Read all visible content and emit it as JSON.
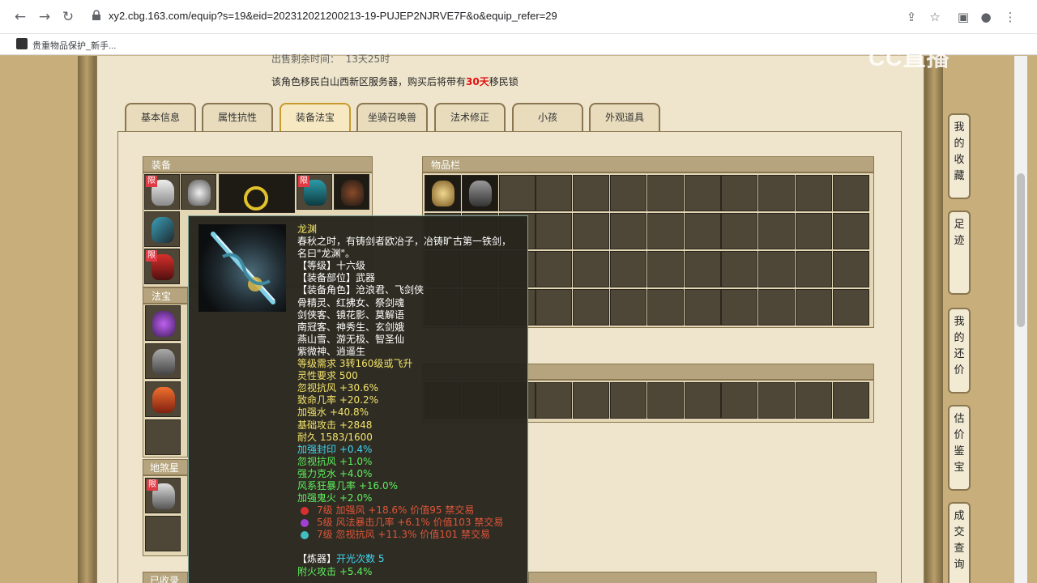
{
  "browser": {
    "url": "xy2.cbg.163.com/equip?s=19&eid=202312021200213-19-PUJEP2NJRVE7F&o&equip_refer=29",
    "bookmark": "贵重物品保护_新手..."
  },
  "watermark": "CC直播",
  "info": {
    "line1_label": "出售剩余时间：",
    "line1_value": "13天25时",
    "line2_pre": "该角色移民白山西新区服务器，购买后将带有",
    "line2_days": "30天",
    "line2_post": "移民锁"
  },
  "tabs": [
    "基本信息",
    "属性抗性",
    "装备法宝",
    "坐骑召唤兽",
    "法术修正",
    "小孩",
    "外观道具"
  ],
  "active_tab": "装备法宝",
  "panels": {
    "equip": "装备",
    "items": "物品栏",
    "magic": "法宝",
    "star": "地煞星",
    "collected": "已收录的"
  },
  "limit_badge": "限",
  "tooltip": {
    "name": "龙渊",
    "lines": [
      {
        "text": "春秋之时，有铸剑者欧冶子，冶铸旷古第一铁剑，",
        "color": "#ffffff"
      },
      {
        "text": "名曰\"龙渊\"。",
        "color": "#ffffff"
      },
      {
        "text": "【等级】十六级",
        "color": "#ffffff"
      },
      {
        "text": "【装备部位】武器",
        "color": "#ffffff"
      },
      {
        "text": "【装备角色】沧浪君、飞剑侠",
        "color": "#ffffff"
      },
      {
        "text": "骨精灵、红拂女、祭剑魂",
        "color": "#ffffff"
      },
      {
        "text": "剑侠客、镜花影、莫解语",
        "color": "#ffffff"
      },
      {
        "text": "南冠客、神秀生、玄剑娥",
        "color": "#ffffff"
      },
      {
        "text": "燕山雪、游无极、智圣仙",
        "color": "#ffffff"
      },
      {
        "text": "紫微神、逍遥生",
        "color": "#ffffff"
      },
      {
        "text": "等级需求 3转160级或飞升",
        "color": "#f3e36a"
      },
      {
        "text": "灵性要求 500",
        "color": "#f3e36a"
      },
      {
        "text": "忽视抗风 +30.6%",
        "color": "#f3e36a"
      },
      {
        "text": "致命几率 +20.2%",
        "color": "#f3e36a"
      },
      {
        "text": "加强水 +40.8%",
        "color": "#f3e36a"
      },
      {
        "text": "基础攻击 +2848",
        "color": "#f3e36a"
      },
      {
        "text": "耐久 1583/1600",
        "color": "#f3e36a"
      },
      {
        "text": "加强封印 +0.4%",
        "color": "#3fd6f0"
      },
      {
        "text": "忽视抗风 +1.0%",
        "color": "#5ef05e"
      },
      {
        "text": "强力克水 +4.0%",
        "color": "#5ef05e"
      },
      {
        "text": "风系狂暴几率 +16.0%",
        "color": "#5ef05e"
      },
      {
        "text": "加强鬼火 +2.0%",
        "color": "#5ef05e"
      }
    ],
    "gems": [
      {
        "text": "7级 加强风 +18.6% 价值95 禁交易",
        "color": "#e0553a",
        "gem": "#d63030"
      },
      {
        "text": "5级 风法暴击几率 +6.1% 价值103 禁交易",
        "color": "#e0553a",
        "gem": "#a040d0"
      },
      {
        "text": "7级 忽视抗风 +11.3% 价值101 禁交易",
        "color": "#e0553a",
        "gem": "#40c0c0"
      }
    ],
    "refine_label": "【炼器】",
    "refine_value": "开光次数 5",
    "refine_extra": "附火攻击 +5.4%"
  },
  "sidebar": [
    "我的收藏",
    "足迹",
    "我的还价",
    "估价鉴宝",
    "成交查询"
  ]
}
